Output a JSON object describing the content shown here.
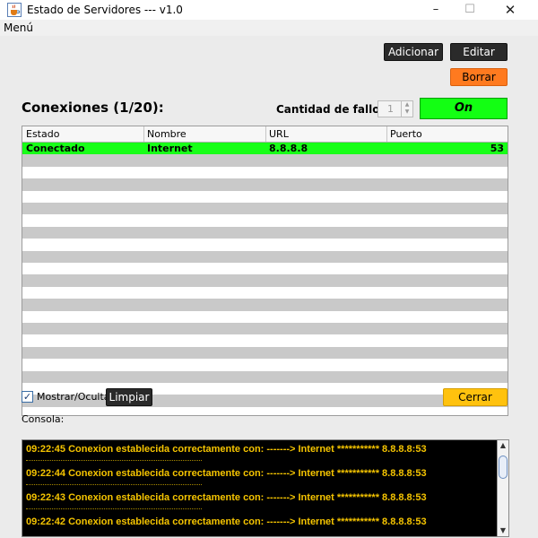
{
  "window": {
    "title": "Estado de Servidores --- v1.0",
    "minimize": "–",
    "maximize": "☐",
    "close": "✕"
  },
  "menu": {
    "label": "Menú"
  },
  "toolbar": {
    "add_label": "Adicionar",
    "edit_label": "Editar",
    "delete_label": "Borrar"
  },
  "connections": {
    "heading": "Conexiones (1/20):",
    "fail_count_label": "Cantidad de fallos:",
    "fail_count_value": "1",
    "status_indicator": "On",
    "status_color": "#13ff13"
  },
  "table": {
    "columns": [
      "Estado",
      "Nombre",
      "URL",
      "Puerto"
    ],
    "rows": [
      {
        "estado": "Conectado",
        "nombre": "Internet",
        "url": "8.8.8.8",
        "puerto": "53"
      }
    ]
  },
  "controls": {
    "show_hide_label": "Mostrar/Ocultar",
    "show_hide_checked": true,
    "clear_label": "Limpiar",
    "close_label": "Cerrar"
  },
  "console": {
    "label": "Consola:",
    "lines": [
      "09:22:45   Conexion establecida correctamente con:  -------> Internet *********** 8.8.8.8:53",
      "09:22:44   Conexion establecida correctamente con:  -------> Internet *********** 8.8.8.8:53",
      "09:22:43   Conexion establecida correctamente con:  -------> Internet *********** 8.8.8.8:53",
      "09:22:42   Conexion establecida correctamente con:  -------> Internet *********** 8.8.8.8:53"
    ],
    "text_color": "#f5c400"
  },
  "icons": {
    "app": "java-cup-icon",
    "check": "checkmark-icon"
  }
}
